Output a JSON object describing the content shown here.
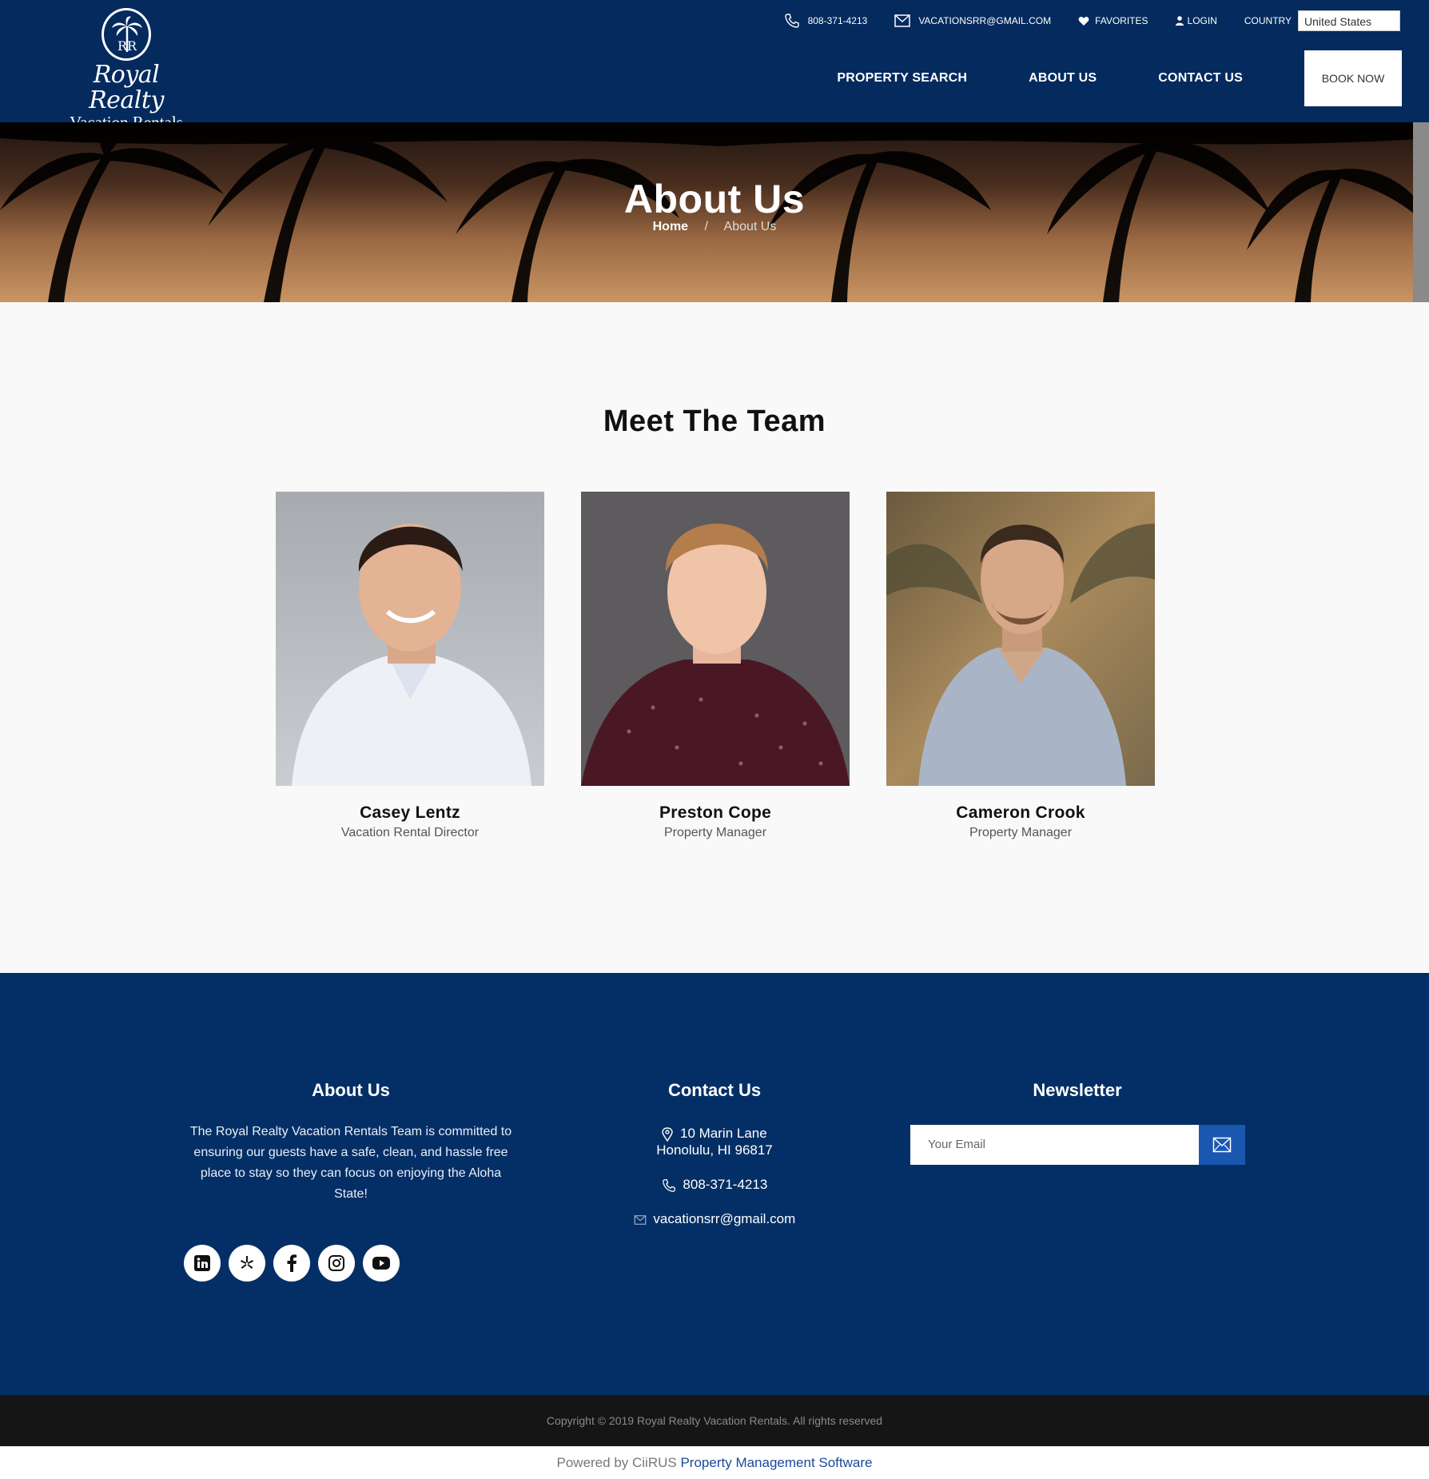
{
  "logo": {
    "script": "Royal Realty",
    "sub": "Vacation Rentals"
  },
  "topbar": {
    "phone": "808-371-4213",
    "email": "VACATIONSRR@GMAIL.COM",
    "favorites": "FAVORITES",
    "login": "LOGIN",
    "country_label": "COUNTRY",
    "country_value": "United States"
  },
  "nav": {
    "items": [
      "PROPERTY SEARCH",
      "ABOUT US",
      "CONTACT US"
    ],
    "book_now": "BOOK NOW"
  },
  "hero": {
    "title": "About Us",
    "breadcrumb": {
      "home": "Home",
      "separator": "/",
      "current": "About Us"
    }
  },
  "team": {
    "title": "Meet The Team",
    "members": [
      {
        "name": "Casey Lentz",
        "role": "Vacation Rental Director"
      },
      {
        "name": "Preston Cope",
        "role": "Property Manager"
      },
      {
        "name": "Cameron Crook",
        "role": "Property Manager"
      }
    ]
  },
  "footer": {
    "about": {
      "title": "About Us",
      "text": "The Royal Realty Vacation Rentals Team is committed to ensuring our guests have a safe, clean, and hassle free place to stay so they can focus on enjoying the Aloha State!",
      "socials": [
        "linkedin-icon",
        "yelp-icon",
        "facebook-icon",
        "instagram-icon",
        "youtube-icon"
      ]
    },
    "contact": {
      "title": "Contact Us",
      "address_line1": "10 Marin Lane",
      "address_line2": "Honolulu, HI 96817",
      "phone": "808-371-4213",
      "email": "vacationsrr@gmail.com"
    },
    "newsletter": {
      "title": "Newsletter",
      "placeholder": "Your Email"
    },
    "copyright": "Copyright © 2019 Royal Realty Vacation Rentals. All rights reserved",
    "powered_by": "Powered by CiiRUS",
    "powered_link": "Property Management Software"
  },
  "colors": {
    "navy": "#042a5e",
    "footer_navy": "#042f66",
    "accent_blue": "#1a57b0",
    "copy_bar": "#151515"
  }
}
